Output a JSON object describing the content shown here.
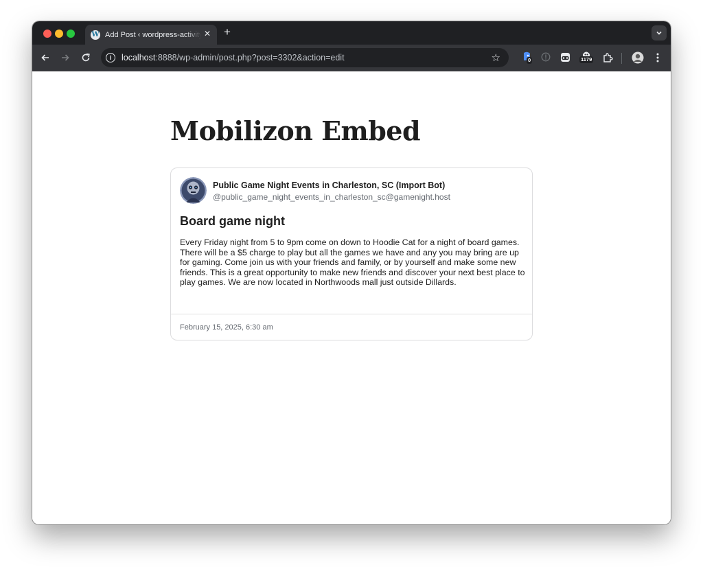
{
  "browser": {
    "tab_title": "Add Post ‹ wordpress-activity",
    "tab_favicon": "wordpress-icon",
    "url_host": "localhost",
    "url_rest": ":8888/wp-admin/post.php?post=3302&action=edit",
    "extension_badges": {
      "first": "0",
      "second": "1179"
    }
  },
  "post": {
    "title": "Mobilizon Embed"
  },
  "embed": {
    "author_name": "Public Game Night Events in Charleston, SC (Import Bot)",
    "author_handle": "@public_game_night_events_in_charleston_sc@gamenight.host",
    "event_title": "Board game night",
    "event_description": "Every Friday night from 5 to 9pm come on down to Hoodie Cat for a night of board games. There will be a $5 charge to play but all the games we have and any you may bring are up for gaming. Come join us with your friends and family, or by yourself and make some new friends. This is a great opportunity to make new friends and discover your next best place to play games. We are now located in Northwoods mall just outside Dillards.",
    "event_date": "February 15, 2025, 6:30 am"
  },
  "colors": {
    "tabstrip": "#1f2023",
    "toolbar": "#35363a",
    "omnibox": "#202124",
    "text": "#1e1e1e",
    "muted": "#646970"
  }
}
